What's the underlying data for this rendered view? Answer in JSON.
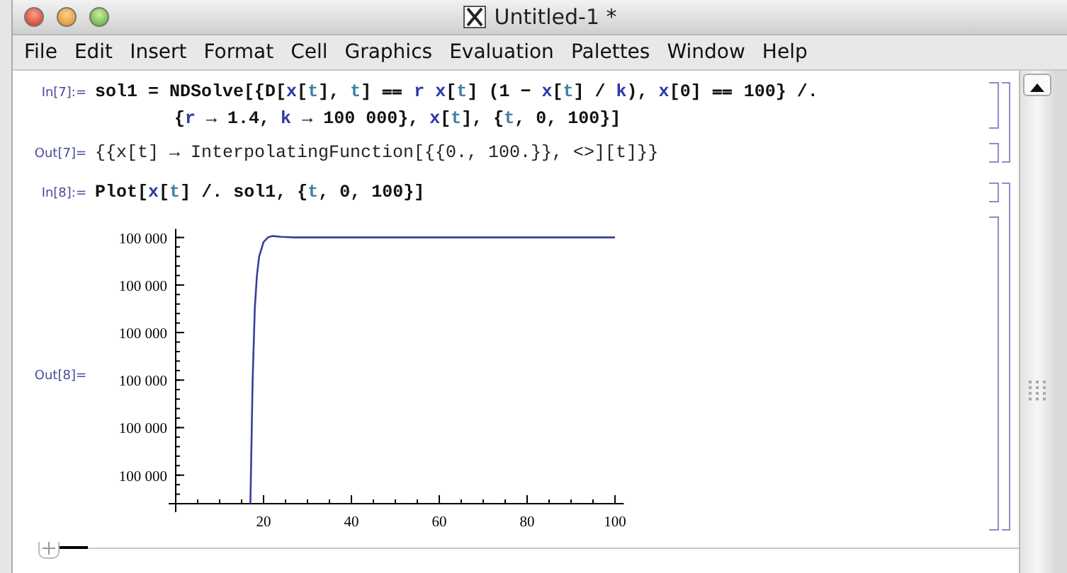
{
  "window": {
    "title": "Untitled-1 *"
  },
  "menu": [
    {
      "label": "File"
    },
    {
      "label": "Edit"
    },
    {
      "label": "Insert"
    },
    {
      "label": "Format"
    },
    {
      "label": "Cell"
    },
    {
      "label": "Graphics"
    },
    {
      "label": "Evaluation"
    },
    {
      "label": "Palettes"
    },
    {
      "label": "Window"
    },
    {
      "label": "Help"
    }
  ],
  "groups": [
    {
      "cells": [
        {
          "kind": "input",
          "label": "In[7]:=",
          "lines": [
            [
              {
                "t": "sol1 = NDSolve[{D["
              },
              {
                "t": "x",
                "color": "#2f3aa8"
              },
              {
                "t": "["
              },
              {
                "t": "t",
                "color": "#3f7fa8"
              },
              {
                "t": "], "
              },
              {
                "t": "t",
                "color": "#3f7fa8"
              },
              {
                "t": "] ⩵ "
              },
              {
                "t": "r ",
                "color": "#2f3aa8"
              },
              {
                "t": "x",
                "color": "#2f3aa8"
              },
              {
                "t": "["
              },
              {
                "t": "t",
                "color": "#3f7fa8"
              },
              {
                "t": "] (1 − "
              },
              {
                "t": "x",
                "color": "#2f3aa8"
              },
              {
                "t": "["
              },
              {
                "t": "t",
                "color": "#3f7fa8"
              },
              {
                "t": "] / "
              },
              {
                "t": "k",
                "color": "#2f3aa8"
              },
              {
                "t": "), "
              },
              {
                "t": "x",
                "color": "#2f3aa8"
              },
              {
                "t": "[0] ⩵ 100} /."
              }
            ],
            [
              {
                "t": "{"
              },
              {
                "t": "r",
                "color": "#2f3aa8"
              },
              {
                "t": " → 1.4, "
              },
              {
                "t": "k",
                "color": "#2f3aa8"
              },
              {
                "t": " → 100 000}, "
              },
              {
                "t": "x",
                "color": "#2f3aa8"
              },
              {
                "t": "["
              },
              {
                "t": "t",
                "color": "#3f7fa8"
              },
              {
                "t": "], {"
              },
              {
                "t": "t",
                "color": "#3f7fa8"
              },
              {
                "t": ", 0, 100}]"
              }
            ]
          ]
        },
        {
          "kind": "output",
          "label": "Out[7]=",
          "lines": [
            [
              {
                "t": "{{x[t] → InterpolatingFunction[{{0., 100.}}, <>][t]}}"
              }
            ]
          ]
        }
      ]
    },
    {
      "cells": [
        {
          "kind": "input",
          "label": "In[8]:=",
          "lines": [
            [
              {
                "t": "Plot["
              },
              {
                "t": "x",
                "color": "#2f3aa8"
              },
              {
                "t": "["
              },
              {
                "t": "t",
                "color": "#3f7fa8"
              },
              {
                "t": "] /. sol1, {"
              },
              {
                "t": "t",
                "color": "#3f7fa8"
              },
              {
                "t": ", 0, 100}]"
              }
            ]
          ]
        },
        {
          "kind": "graphics",
          "label": "Out[8]=",
          "y_axis_labels": [
            "100 000",
            "100 000",
            "100 000",
            "100 000",
            "100 000",
            "100 000"
          ],
          "plot": {
            "x_axis_labels": [
              "20",
              "40",
              "60",
              "80",
              "100"
            ]
          }
        }
      ]
    }
  ]
}
